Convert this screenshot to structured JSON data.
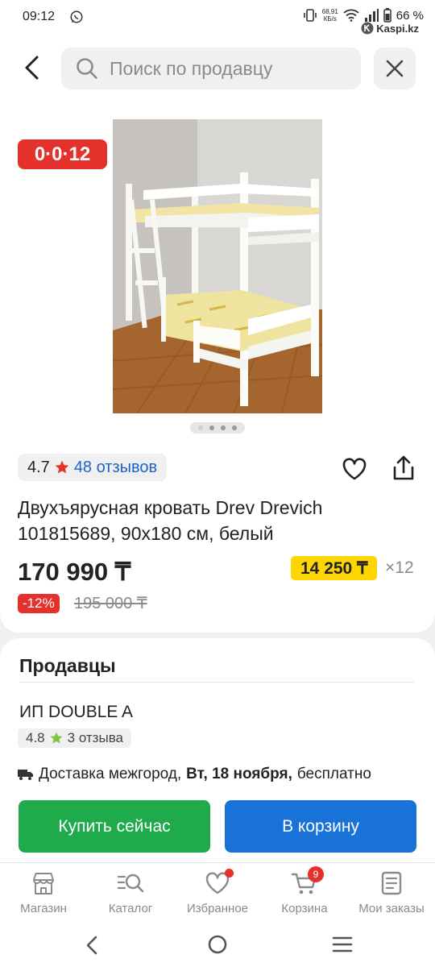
{
  "status_bar": {
    "time": "09:12",
    "net_speed_value": "68,91",
    "net_speed_unit": "КБ/s",
    "battery": "66 %",
    "watermark": "Kaspi.kz"
  },
  "search": {
    "placeholder": "Поиск по продавцу"
  },
  "product": {
    "promo_badge": "0·0·12",
    "image_count": 4,
    "active_image_index": 0,
    "rating": "4.7",
    "reviews": "48 отзывов",
    "title": "Двухъярусная кровать Drev Drevich 101815689, 90х180 см, белый",
    "price": "170 990 ₸",
    "monthly_payment": "14 250 ₸",
    "installment_months": "×12",
    "discount": "-12%",
    "old_price": "195 000 ₸"
  },
  "sellers": {
    "title": "Продавцы",
    "seller_name": "ИП DOUBLE A",
    "seller_rating": "4.8",
    "seller_reviews": "3 отзыва",
    "delivery_prefix": "Доставка межгород,",
    "delivery_date": "Вт, 18 ноября,",
    "delivery_suffix": "бесплатно",
    "buy_now_label": "Купить сейчас",
    "add_to_cart_label": "В корзину"
  },
  "bottom_nav": {
    "items": [
      {
        "label": "Магазин",
        "icon": "shop-icon"
      },
      {
        "label": "Каталог",
        "icon": "catalog-search-icon"
      },
      {
        "label": "Избранное",
        "icon": "heart-icon"
      },
      {
        "label": "Корзина",
        "icon": "cart-icon"
      },
      {
        "label": "Мои заказы",
        "icon": "orders-icon"
      }
    ],
    "cart_badge": "9"
  },
  "colors": {
    "accent_red": "#e5312b",
    "buy_green": "#1fab4c",
    "cart_blue": "#1872d8",
    "monthly_yellow": "#ffd600",
    "link_blue": "#1a64c8"
  }
}
